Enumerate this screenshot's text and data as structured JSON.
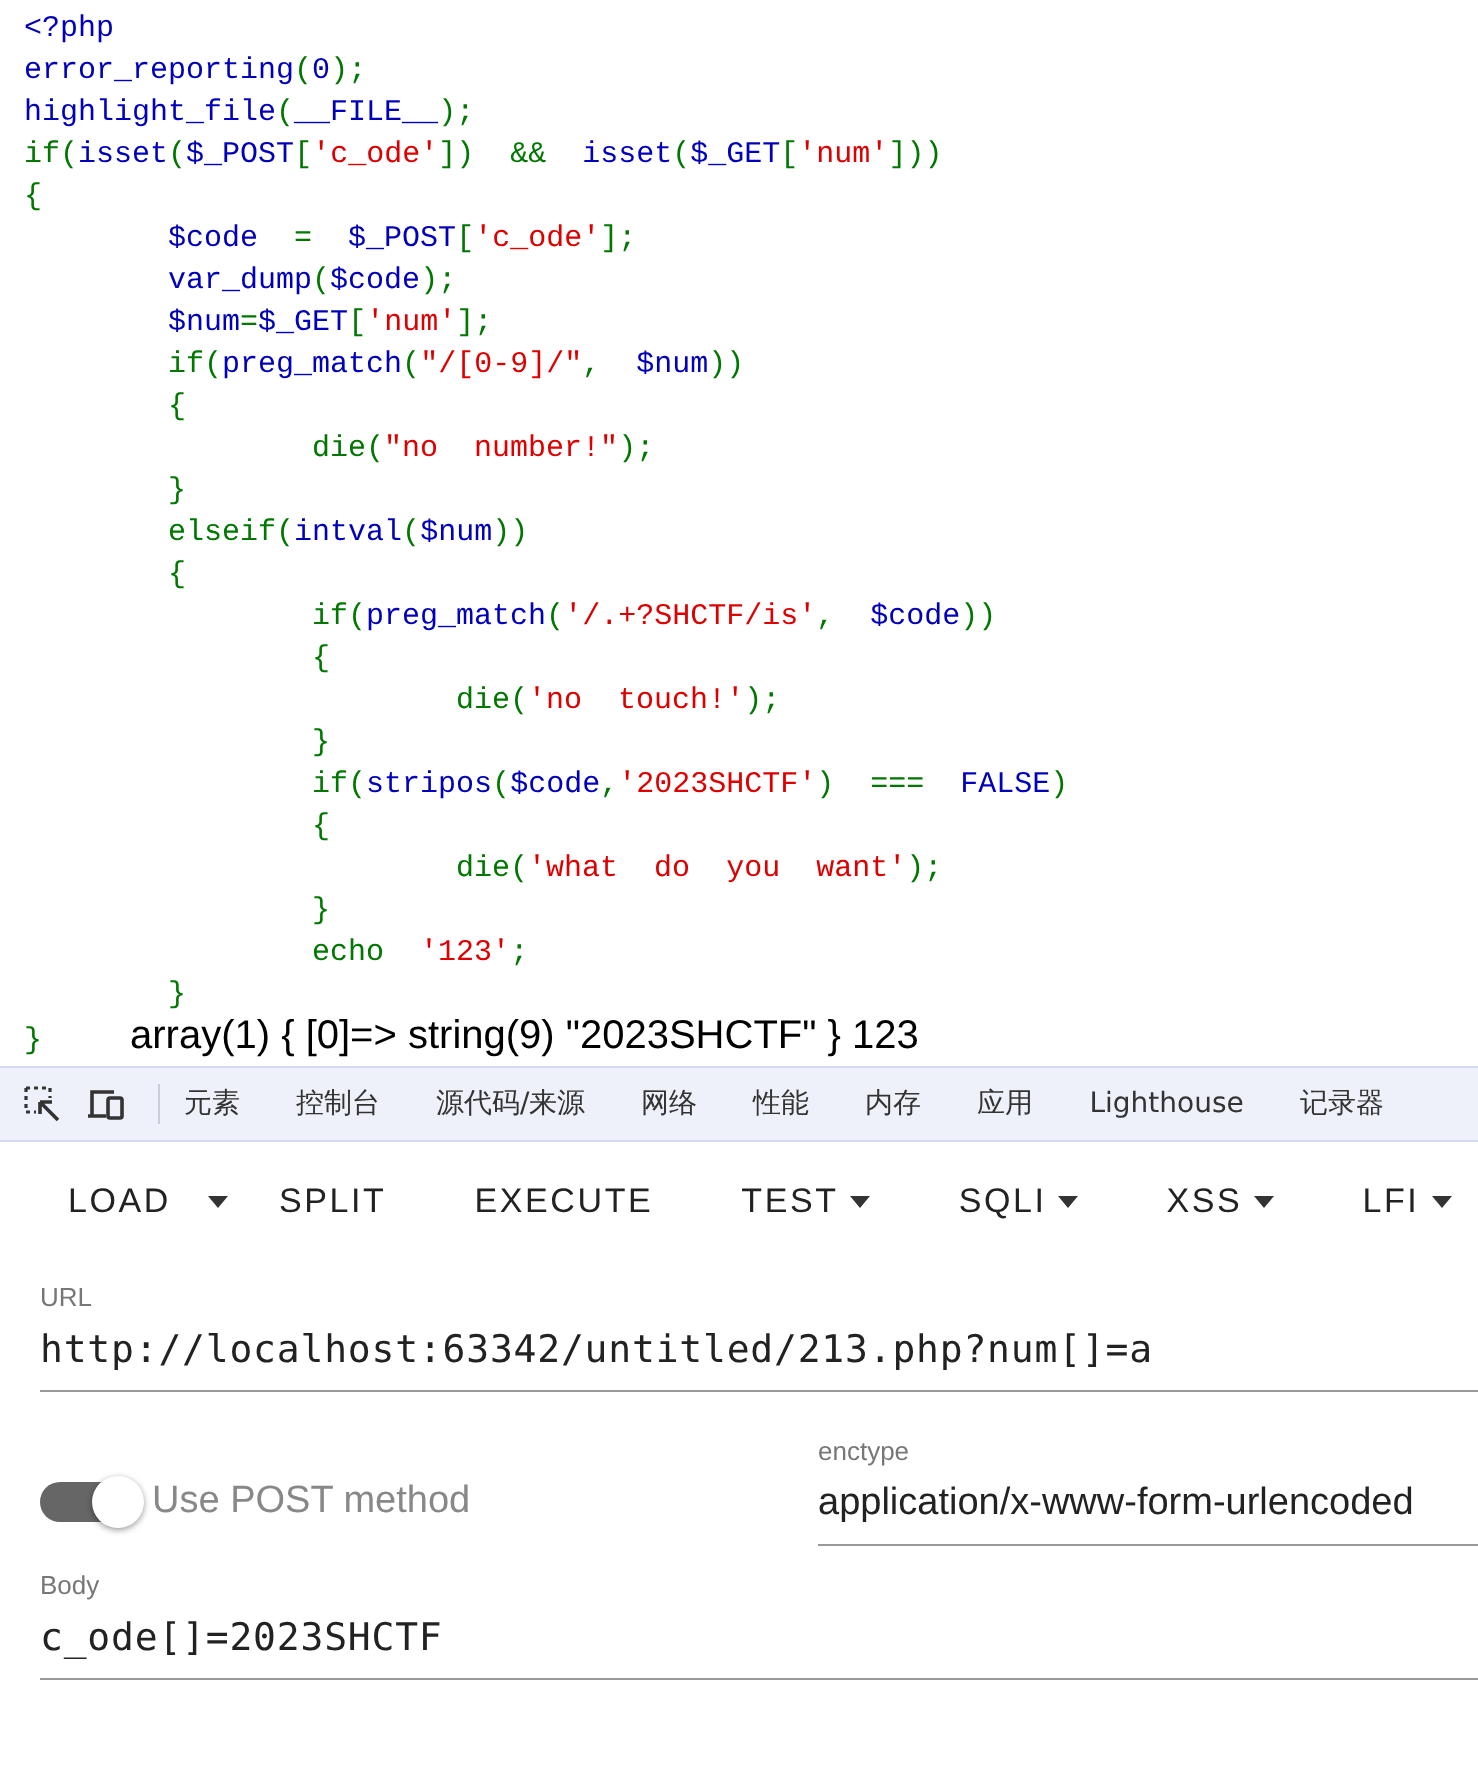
{
  "source": {
    "lines": [
      [
        {
          "kind": "default",
          "text": "<?php"
        }
      ],
      [
        {
          "kind": "default",
          "text": "error_reporting"
        },
        {
          "kind": "keyword",
          "text": "("
        },
        {
          "kind": "default",
          "text": "0"
        },
        {
          "kind": "keyword",
          "text": ");"
        }
      ],
      [
        {
          "kind": "default",
          "text": "highlight_file"
        },
        {
          "kind": "keyword",
          "text": "("
        },
        {
          "kind": "default",
          "text": "__FILE__"
        },
        {
          "kind": "keyword",
          "text": ");"
        }
      ],
      [
        {
          "kind": "keyword",
          "text": "if("
        },
        {
          "kind": "default",
          "text": "isset"
        },
        {
          "kind": "keyword",
          "text": "("
        },
        {
          "kind": "default",
          "text": "$_POST"
        },
        {
          "kind": "keyword",
          "text": "["
        },
        {
          "kind": "string",
          "text": "'c_ode'"
        },
        {
          "kind": "keyword",
          "text": "])  &&  "
        },
        {
          "kind": "default",
          "text": "isset"
        },
        {
          "kind": "keyword",
          "text": "("
        },
        {
          "kind": "default",
          "text": "$_GET"
        },
        {
          "kind": "keyword",
          "text": "["
        },
        {
          "kind": "string",
          "text": "'num'"
        },
        {
          "kind": "keyword",
          "text": "]))"
        }
      ],
      [
        {
          "kind": "keyword",
          "text": "{"
        }
      ],
      [
        {
          "kind": "default",
          "text": "        $code"
        },
        {
          "kind": "keyword",
          "text": "  =  "
        },
        {
          "kind": "default",
          "text": "$_POST"
        },
        {
          "kind": "keyword",
          "text": "["
        },
        {
          "kind": "string",
          "text": "'c_ode'"
        },
        {
          "kind": "keyword",
          "text": "];"
        }
      ],
      [
        {
          "kind": "default",
          "text": "        var_dump"
        },
        {
          "kind": "keyword",
          "text": "("
        },
        {
          "kind": "default",
          "text": "$code"
        },
        {
          "kind": "keyword",
          "text": ");"
        }
      ],
      [
        {
          "kind": "default",
          "text": "        $num"
        },
        {
          "kind": "keyword",
          "text": "="
        },
        {
          "kind": "default",
          "text": "$_GET"
        },
        {
          "kind": "keyword",
          "text": "["
        },
        {
          "kind": "string",
          "text": "'num'"
        },
        {
          "kind": "keyword",
          "text": "];"
        }
      ],
      [
        {
          "kind": "keyword",
          "text": "        if("
        },
        {
          "kind": "default",
          "text": "preg_match"
        },
        {
          "kind": "keyword",
          "text": "("
        },
        {
          "kind": "string",
          "text": "\"/[0-9]/\""
        },
        {
          "kind": "keyword",
          "text": ",  "
        },
        {
          "kind": "default",
          "text": "$num"
        },
        {
          "kind": "keyword",
          "text": "))"
        }
      ],
      [
        {
          "kind": "keyword",
          "text": "        {"
        }
      ],
      [
        {
          "kind": "keyword",
          "text": "                die("
        },
        {
          "kind": "string",
          "text": "\"no  number!\""
        },
        {
          "kind": "keyword",
          "text": ");"
        }
      ],
      [
        {
          "kind": "keyword",
          "text": "        }"
        }
      ],
      [
        {
          "kind": "keyword",
          "text": "        elseif("
        },
        {
          "kind": "default",
          "text": "intval"
        },
        {
          "kind": "keyword",
          "text": "("
        },
        {
          "kind": "default",
          "text": "$num"
        },
        {
          "kind": "keyword",
          "text": "))"
        }
      ],
      [
        {
          "kind": "keyword",
          "text": "        {"
        }
      ],
      [
        {
          "kind": "keyword",
          "text": "                if("
        },
        {
          "kind": "default",
          "text": "preg_match"
        },
        {
          "kind": "keyword",
          "text": "("
        },
        {
          "kind": "string",
          "text": "'/.+?SHCTF/is'"
        },
        {
          "kind": "keyword",
          "text": ",  "
        },
        {
          "kind": "default",
          "text": "$code"
        },
        {
          "kind": "keyword",
          "text": "))"
        }
      ],
      [
        {
          "kind": "keyword",
          "text": "                {"
        }
      ],
      [
        {
          "kind": "keyword",
          "text": "                        die("
        },
        {
          "kind": "string",
          "text": "'no  touch!'"
        },
        {
          "kind": "keyword",
          "text": ");"
        }
      ],
      [
        {
          "kind": "keyword",
          "text": "                }"
        }
      ],
      [
        {
          "kind": "keyword",
          "text": "                if("
        },
        {
          "kind": "default",
          "text": "stripos"
        },
        {
          "kind": "keyword",
          "text": "("
        },
        {
          "kind": "default",
          "text": "$code"
        },
        {
          "kind": "keyword",
          "text": ","
        },
        {
          "kind": "string",
          "text": "'2023SHCTF'"
        },
        {
          "kind": "keyword",
          "text": ")  ===  "
        },
        {
          "kind": "default",
          "text": "FALSE"
        },
        {
          "kind": "keyword",
          "text": ")"
        }
      ],
      [
        {
          "kind": "keyword",
          "text": "                {"
        }
      ],
      [
        {
          "kind": "keyword",
          "text": "                        die("
        },
        {
          "kind": "string",
          "text": "'what  do  you  want'"
        },
        {
          "kind": "keyword",
          "text": ");"
        }
      ],
      [
        {
          "kind": "keyword",
          "text": "                }"
        }
      ],
      [
        {
          "kind": "keyword",
          "text": "                echo  "
        },
        {
          "kind": "string",
          "text": "'123'"
        },
        {
          "kind": "keyword",
          "text": ";"
        }
      ],
      [
        {
          "kind": "keyword",
          "text": "        }"
        }
      ],
      [
        {
          "kind": "keyword",
          "text": "}"
        }
      ]
    ],
    "output": "array(1) { [0]=> string(9) \"2023SHCTF\" } 123"
  },
  "devtools": {
    "tabs": [
      "元素",
      "控制台",
      "源代码/来源",
      "网络",
      "性能",
      "内存",
      "应用",
      "Lighthouse",
      "记录器"
    ]
  },
  "hackbar": {
    "toolbar": [
      {
        "kind": "split",
        "label": "LOAD"
      },
      {
        "kind": "plain",
        "label": "SPLIT"
      },
      {
        "kind": "plain",
        "label": "EXECUTE"
      },
      {
        "kind": "menu",
        "label": "TEST"
      },
      {
        "kind": "menu",
        "label": "SQLI"
      },
      {
        "kind": "menu",
        "label": "XSS"
      },
      {
        "kind": "menu",
        "label": "LFI"
      }
    ],
    "url": {
      "label": "URL",
      "value": "http://localhost:63342/untitled/213.php?num[]=a"
    },
    "post": {
      "label": "Use POST method",
      "on": true
    },
    "enctype": {
      "label": "enctype",
      "value": "application/x-www-form-urlencoded"
    },
    "body": {
      "label": "Body",
      "value": "c_ode[]=2023SHCTF"
    }
  }
}
